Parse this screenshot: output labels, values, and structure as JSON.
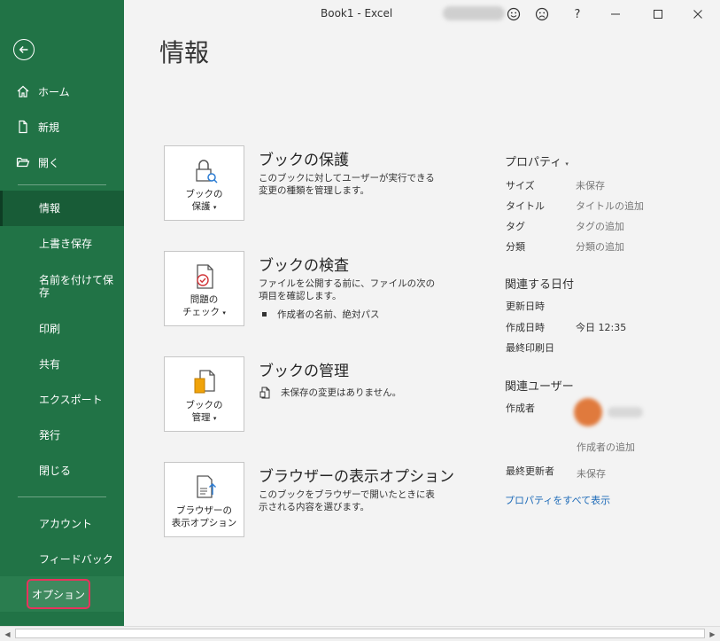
{
  "window": {
    "title": "Book1  -  Excel",
    "help": "?"
  },
  "sidebar": {
    "top": [
      {
        "label": "ホーム",
        "icon": "home-icon"
      },
      {
        "label": "新規",
        "icon": "new-file-icon"
      },
      {
        "label": "開く",
        "icon": "folder-open-icon"
      }
    ],
    "main": [
      {
        "label": "情報",
        "active": true
      },
      {
        "label": "上書き保存"
      },
      {
        "label": "名前を付けて保存"
      },
      {
        "label": "印刷"
      },
      {
        "label": "共有"
      },
      {
        "label": "エクスポート"
      },
      {
        "label": "発行"
      },
      {
        "label": "閉じる"
      }
    ],
    "bottom": [
      {
        "label": "アカウント"
      },
      {
        "label": "フィードバック"
      },
      {
        "label": "オプション",
        "highlighted": true
      }
    ]
  },
  "page": {
    "title": "情報"
  },
  "sections": {
    "protect": {
      "button_label": "ブックの\n保護",
      "title": "ブックの保護",
      "desc": "このブックに対してユーザーが実行できる変更の種類を管理します。"
    },
    "inspect": {
      "button_label": "問題の\nチェック",
      "title": "ブックの検査",
      "desc": "ファイルを公開する前に、ファイルの次の項目を確認します。",
      "bullet": "作成者の名前、絶対パス"
    },
    "manage": {
      "button_label": "ブックの\n管理",
      "title": "ブックの管理",
      "status": "未保存の変更はありません。"
    },
    "browser": {
      "button_label": "ブラウザーの\n表示オプション",
      "title": "ブラウザーの表示オプション",
      "desc": "このブックをブラウザーで開いたときに表示される内容を選びます。"
    }
  },
  "properties": {
    "heading": "プロパティ",
    "rows": [
      {
        "label": "サイズ",
        "value": "未保存"
      },
      {
        "label": "タイトル",
        "value": "タイトルの追加"
      },
      {
        "label": "タグ",
        "value": "タグの追加"
      },
      {
        "label": "分類",
        "value": "分類の追加"
      }
    ],
    "dates_heading": "関連する日付",
    "dates": [
      {
        "label": "更新日時",
        "value": ""
      },
      {
        "label": "作成日時",
        "value": "今日 12:35"
      },
      {
        "label": "最終印刷日",
        "value": ""
      }
    ],
    "users_heading": "関連ユーザー",
    "author_label": "作成者",
    "add_author": "作成者の追加",
    "last_modified_label": "最終更新者",
    "last_modified_value": "未保存",
    "show_all": "プロパティをすべて表示"
  },
  "colors": {
    "sidebar": "#217346",
    "active": "#185c37",
    "highlight_border": "#e8335d",
    "link": "#1e6bb8"
  }
}
